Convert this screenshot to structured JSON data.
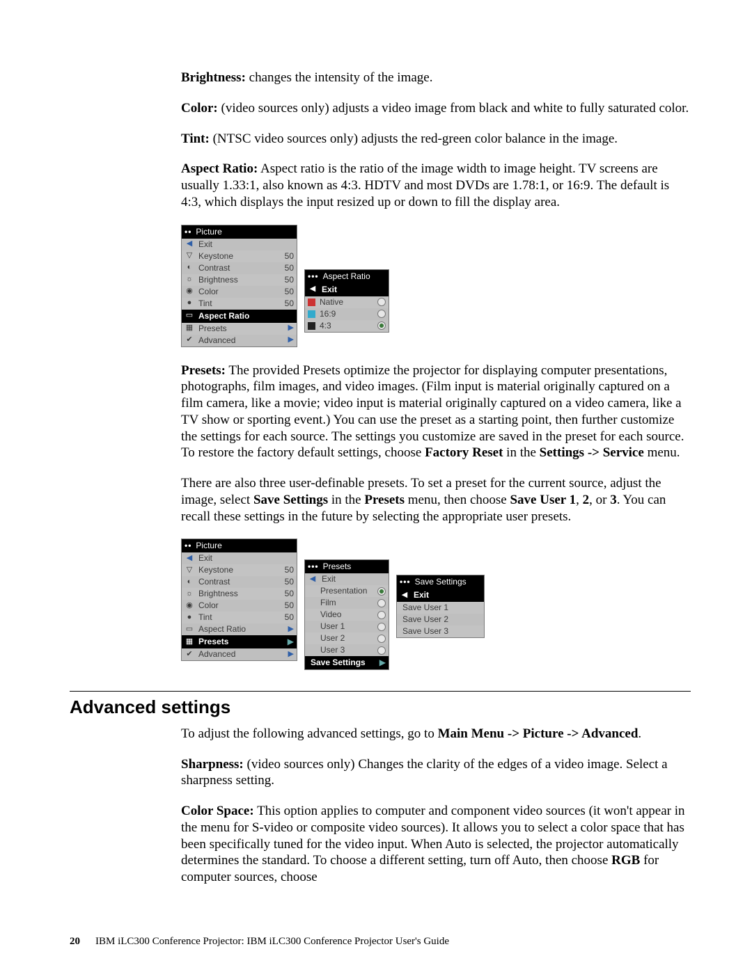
{
  "paragraphs": {
    "brightness_label": "Brightness:",
    "brightness_text": " changes the intensity of the image.",
    "color_label": "Color:",
    "color_text": " (video sources only) adjusts a video image from black and white to fully saturated color.",
    "tint_label": "Tint:",
    "tint_text": " (NTSC video sources only) adjusts the red-green color balance in the image.",
    "aspect_label": "Aspect Ratio:",
    "aspect_text": " Aspect ratio is the ratio of the image width to image height. TV screens are usually 1.33:1, also known as 4:3. HDTV and most DVDs are 1.78:1, or 16:9. The default is 4:3, which displays the input resized up or down to fill the display area.",
    "presets_label": "Presets:",
    "presets_text_a": " The provided Presets optimize the projector for displaying computer presentations, photographs, film images, and video images. (Film input is material originally captured on a film camera, like a movie; video input is material originally captured on a video camera, like a TV show or sporting event.) You can use the preset as a starting point, then further customize the settings for each source. The settings you customize are saved in the preset for each source. To restore the factory default settings, choose ",
    "presets_bold_a": "Factory Reset",
    "presets_text_b": " in the ",
    "presets_bold_b": "Settings -> Service",
    "presets_text_c": " menu.",
    "user_presets_a": "There are also three user-definable presets. To set a preset for the current source, adjust the image, select ",
    "user_presets_bold_a": "Save Settings",
    "user_presets_b": " in the ",
    "user_presets_bold_b": "Presets",
    "user_presets_c": " menu, then choose ",
    "user_presets_bold_c": "Save User 1",
    "user_presets_d": ", ",
    "user_presets_bold_d": "2",
    "user_presets_e": ", or ",
    "user_presets_bold_e": "3",
    "user_presets_f": ". You can recall these settings in the future by selecting the appropriate user presets."
  },
  "section2": {
    "title": "Advanced settings",
    "intro_a": "To adjust the following advanced settings, go to ",
    "intro_bold": "Main Menu -> Picture -> Advanced",
    "intro_b": ".",
    "sharpness_label": "Sharpness:",
    "sharpness_text": " (video sources only) Changes the clarity of the edges of a video image. Select a sharpness setting.",
    "colorspace_label": "Color Space:",
    "colorspace_text_a": " This option applies to computer and component video sources (it won't appear in the menu for S-video or composite video sources). It allows you to select a color space that has been specifically tuned for the video input. When Auto is selected, the projector automatically determines the standard. To choose a different setting, turn off Auto, then choose ",
    "colorspace_bold": "RGB",
    "colorspace_text_b": " for computer sources, choose"
  },
  "osd1": {
    "picture_header": "Picture",
    "items": {
      "exit": "Exit",
      "keystone": "Keystone",
      "contrast": "Contrast",
      "brightness": "Brightness",
      "color": "Color",
      "tint": "Tint",
      "aspect": "Aspect Ratio",
      "presets": "Presets",
      "advanced": "Advanced"
    },
    "vals": {
      "keystone": "50",
      "contrast": "50",
      "brightness": "50",
      "color": "50",
      "tint": "50"
    },
    "aspect_header": "Aspect Ratio",
    "aspect_items": {
      "exit": "Exit",
      "native": "Native",
      "r169": "16:9",
      "r43": "4:3"
    }
  },
  "osd2": {
    "picture_header": "Picture",
    "items": {
      "exit": "Exit",
      "keystone": "Keystone",
      "contrast": "Contrast",
      "brightness": "Brightness",
      "color": "Color",
      "tint": "Tint",
      "aspect": "Aspect Ratio",
      "presets": "Presets",
      "advanced": "Advanced"
    },
    "vals": {
      "keystone": "50",
      "contrast": "50",
      "brightness": "50",
      "color": "50",
      "tint": "50"
    },
    "presets_header": "Presets",
    "presets_items": {
      "exit": "Exit",
      "presentation": "Presentation",
      "film": "Film",
      "video": "Video",
      "user1": "User 1",
      "user2": "User 2",
      "user3": "User 3",
      "save": "Save Settings"
    },
    "save_header": "Save Settings",
    "save_items": {
      "exit": "Exit",
      "s1": "Save User 1",
      "s2": "Save User 2",
      "s3": "Save User 3"
    }
  },
  "footer": {
    "page": "20",
    "text": "IBM iLC300 Conference Projector: IBM iLC300 Conference Projector User's Guide"
  },
  "glyphs": {
    "tri_left": "◀",
    "tri_right": "▶",
    "dots2": "••",
    "dots3": "•••"
  }
}
